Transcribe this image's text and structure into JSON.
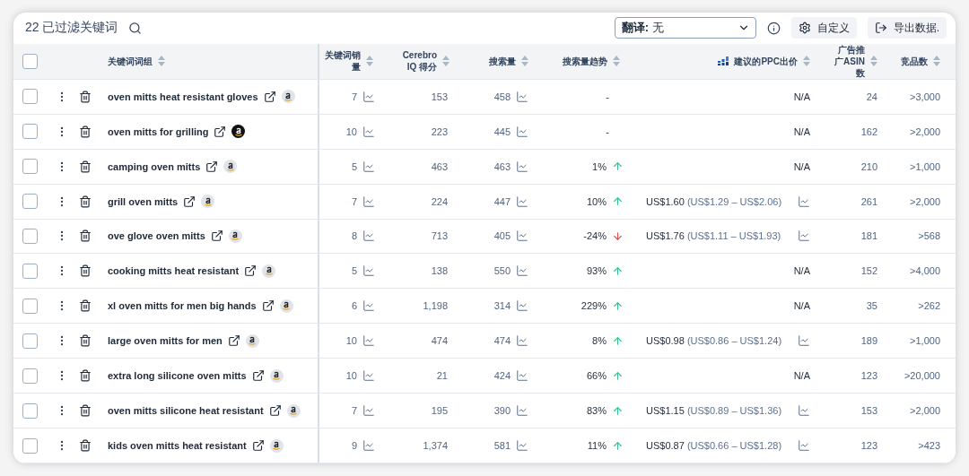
{
  "toolbar": {
    "count_label": "22 已过滤关键词",
    "translate": {
      "label": "翻译:",
      "value": "无"
    },
    "buttons": [
      {
        "kind": "settings",
        "label": "自定义"
      },
      {
        "kind": "export",
        "label": "导出数据."
      }
    ]
  },
  "header": {
    "select_all": {
      "checked": false
    },
    "columns": [
      {
        "label": "关键词词组"
      },
      {
        "label": "关键词销量"
      },
      {
        "label": "Cerebro IQ 得分"
      },
      {
        "label": "搜索量"
      },
      {
        "label": "搜索量趋势"
      },
      {
        "label": "建议的PPC出价"
      },
      {
        "label": "广告推广ASIN数"
      },
      {
        "label": "竞品数"
      }
    ]
  },
  "rows": [
    {
      "checked": false,
      "keyword": "oven mitts heat resistant gloves",
      "amazon_highlighted": false,
      "sales": "7",
      "cerebro": "153",
      "search": "458",
      "trend": "-",
      "kind": "flat",
      "ppc": null,
      "ppc_na": "N/A",
      "asin": "24",
      "competitors": ">3,000"
    },
    {
      "checked": false,
      "keyword": "oven mitts for grilling",
      "amazon_highlighted": true,
      "sales": "10",
      "cerebro": "223",
      "search": "445",
      "trend": "-",
      "kind": "flat",
      "ppc": null,
      "ppc_na": "N/A",
      "asin": "162",
      "competitors": ">2,000"
    },
    {
      "checked": false,
      "keyword": "camping oven mitts",
      "amazon_highlighted": false,
      "sales": "5",
      "cerebro": "463",
      "search": "463",
      "trend": "1%",
      "kind": "rising",
      "ppc": null,
      "ppc_na": "N/A",
      "asin": "210",
      "competitors": ">1,000"
    },
    {
      "checked": false,
      "keyword": "grill oven mitts",
      "amazon_highlighted": false,
      "sales": "7",
      "cerebro": "224",
      "search": "447",
      "trend": "10%",
      "kind": "rising",
      "ppc": {
        "bid": "US$1.60",
        "range": "(US$1.29 – US$2.06)"
      },
      "asin": "261",
      "competitors": ">2,000"
    },
    {
      "checked": false,
      "keyword": "ove glove oven mitts",
      "amazon_highlighted": false,
      "sales": "8",
      "cerebro": "713",
      "search": "405",
      "trend": "-24%",
      "kind": "falling",
      "ppc": {
        "bid": "US$1.76",
        "range": "(US$1.11 – US$1.93)"
      },
      "asin": "181",
      "competitors": ">568"
    },
    {
      "checked": false,
      "keyword": "cooking mitts heat resistant",
      "amazon_highlighted": false,
      "sales": "5",
      "cerebro": "138",
      "search": "550",
      "trend": "93%",
      "kind": "rising",
      "ppc": null,
      "ppc_na": "N/A",
      "asin": "152",
      "competitors": ">4,000"
    },
    {
      "checked": false,
      "keyword": "xl oven mitts for men big hands",
      "amazon_highlighted": false,
      "sales": "6",
      "cerebro": "1,198",
      "search": "314",
      "trend": "229%",
      "kind": "rising",
      "ppc": null,
      "ppc_na": "N/A",
      "asin": "35",
      "competitors": ">262"
    },
    {
      "checked": false,
      "keyword": "large oven mitts for men",
      "amazon_highlighted": false,
      "sales": "10",
      "cerebro": "474",
      "search": "474",
      "trend": "8%",
      "kind": "rising",
      "ppc": {
        "bid": "US$0.98",
        "range": "(US$0.86 – US$1.24)"
      },
      "asin": "189",
      "competitors": ">1,000"
    },
    {
      "checked": false,
      "keyword": "extra long silicone oven mitts",
      "amazon_highlighted": false,
      "sales": "10",
      "cerebro": "21",
      "search": "424",
      "trend": "66%",
      "kind": "rising",
      "ppc": null,
      "ppc_na": "N/A",
      "asin": "123",
      "competitors": ">20,000"
    },
    {
      "checked": false,
      "keyword": "oven mitts silicone heat resistant",
      "amazon_highlighted": false,
      "sales": "7",
      "cerebro": "195",
      "search": "390",
      "trend": "83%",
      "kind": "rising",
      "ppc": {
        "bid": "US$1.15",
        "range": "(US$0.89 – US$1.36)"
      },
      "asin": "153",
      "competitors": ">2,000"
    },
    {
      "checked": false,
      "keyword": "kids oven mitts heat resistant",
      "amazon_highlighted": false,
      "sales": "9",
      "cerebro": "1,374",
      "search": "581",
      "trend": "11%",
      "kind": "rising",
      "ppc": {
        "bid": "US$0.87",
        "range": "(US$0.66 – US$1.28)"
      },
      "asin": "123",
      "competitors": ">423"
    }
  ]
}
